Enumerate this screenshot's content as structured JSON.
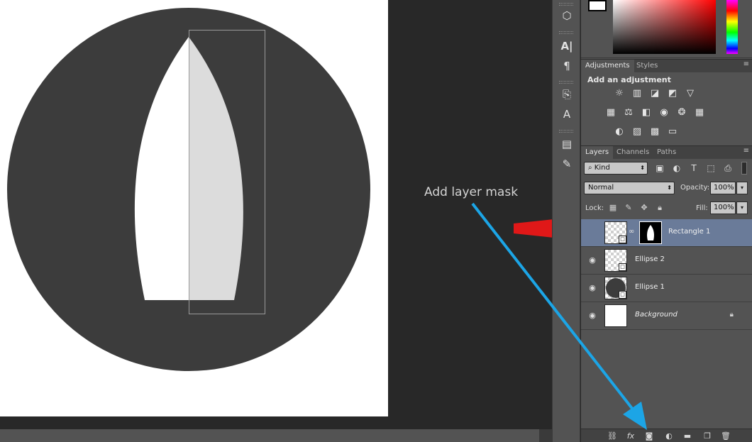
{
  "annotation": {
    "label": "Add layer mask",
    "arrow_red_color": "#e01818",
    "arrow_blue_color": "#1ca5e6"
  },
  "canvas": {
    "background_color": "#282828",
    "document_color": "#ffffff",
    "circle_color": "#3c3c3c",
    "shape_color": "#ffffff",
    "masked_half_color": "#dcdcdc"
  },
  "tools": {
    "items": [
      "3d-panel-icon",
      "character-panel-icon",
      "paragraph-panel-icon",
      "clone-source-icon",
      "character-styles-icon",
      "history-panel-icon",
      "notes-icon"
    ]
  },
  "adjustments": {
    "tabs": [
      "Adjustments",
      "Styles"
    ],
    "title": "Add an adjustment",
    "icons": [
      "brightness-contrast-icon",
      "levels-icon",
      "curves-icon",
      "exposure-icon",
      "vibrance-icon",
      "hue-saturation-icon",
      "color-balance-icon",
      "black-white-icon",
      "photo-filter-icon",
      "channel-mixer-icon",
      "color-lookup-icon",
      "invert-icon",
      "posterize-icon",
      "threshold-icon",
      "gradient-map-icon"
    ]
  },
  "layers_panel": {
    "tabs": [
      "Layers",
      "Channels",
      "Paths"
    ],
    "filter_kind": "Kind",
    "blend_mode": "Normal",
    "opacity_label": "Opacity:",
    "opacity_value": "100%",
    "lock_label": "Lock:",
    "fill_label": "Fill:",
    "fill_value": "100%",
    "layers": [
      {
        "name": "Rectangle 1",
        "selected": true,
        "has_mask": true
      },
      {
        "name": "Ellipse 2",
        "selected": false
      },
      {
        "name": "Ellipse 1",
        "selected": false
      },
      {
        "name": "Background",
        "selected": false,
        "locked": true
      }
    ],
    "bottom_icons": [
      "link-layers-icon",
      "fx-icon",
      "add-layer-mask-icon",
      "adjustment-layer-icon",
      "new-group-icon",
      "new-layer-icon",
      "delete-layer-icon"
    ]
  }
}
